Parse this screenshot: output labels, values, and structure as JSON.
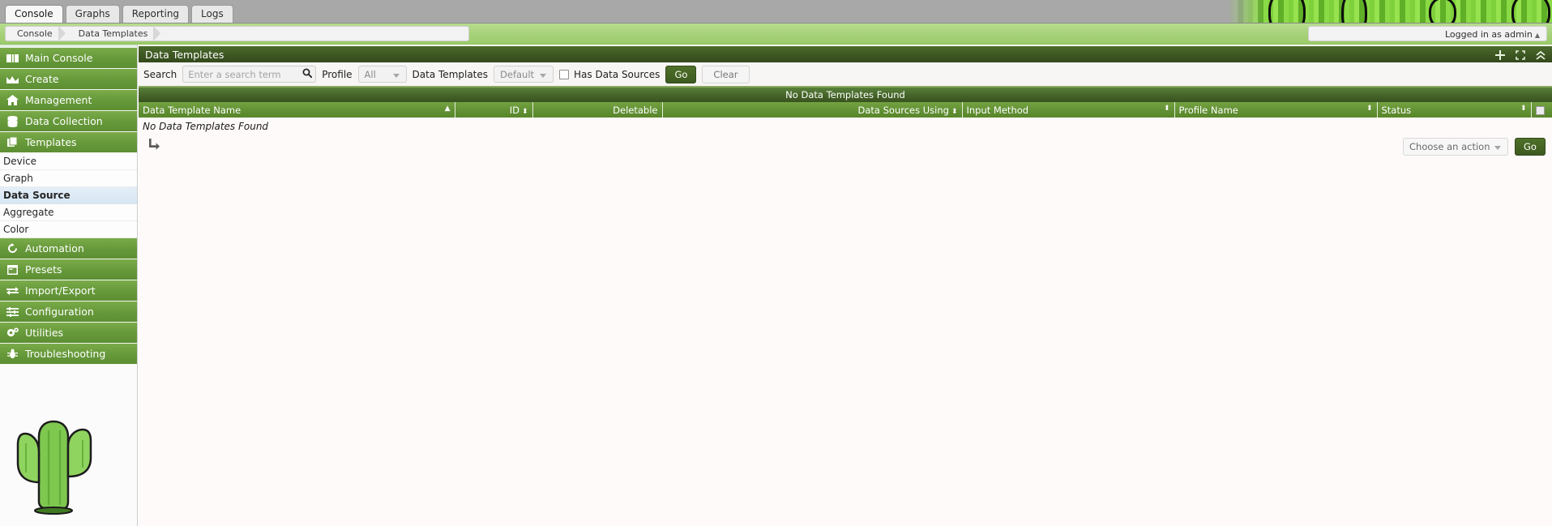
{
  "topbar": {
    "tabs": [
      {
        "label": "Console",
        "active": true
      },
      {
        "label": "Graphs",
        "active": false
      },
      {
        "label": "Reporting",
        "active": false
      },
      {
        "label": "Logs",
        "active": false
      }
    ],
    "banner_icon": "cactus-banner-graphic"
  },
  "breadcrumb": {
    "items": [
      "Console",
      "Data Templates"
    ],
    "login_text": "Logged in as admin",
    "login_caret": "▲"
  },
  "sidebar": {
    "groups": [
      {
        "label": "Main Console",
        "icon": "book-icon"
      },
      {
        "label": "Create",
        "icon": "chart-icon"
      },
      {
        "label": "Management",
        "icon": "home-icon"
      },
      {
        "label": "Data Collection",
        "icon": "database-icon"
      },
      {
        "label": "Templates",
        "icon": "layers-icon"
      }
    ],
    "template_items": [
      {
        "label": "Device",
        "selected": false
      },
      {
        "label": "Graph",
        "selected": false
      },
      {
        "label": "Data Source",
        "selected": true
      },
      {
        "label": "Aggregate",
        "selected": false
      },
      {
        "label": "Color",
        "selected": false
      }
    ],
    "groups_lower": [
      {
        "label": "Automation",
        "icon": "refresh-icon"
      },
      {
        "label": "Presets",
        "icon": "window-icon"
      },
      {
        "label": "Import/Export",
        "icon": "exchange-icon"
      },
      {
        "label": "Configuration",
        "icon": "sliders-icon"
      },
      {
        "label": "Utilities",
        "icon": "gears-icon"
      },
      {
        "label": "Troubleshooting",
        "icon": "bug-icon"
      }
    ],
    "mascot": "cactus-logo"
  },
  "panel": {
    "title": "Data Templates",
    "icons": [
      {
        "name": "add-icon",
        "glyph": "+"
      },
      {
        "name": "expand-icon",
        "glyph": "[ ]"
      },
      {
        "name": "collapse-icon",
        "glyph": "A"
      }
    ]
  },
  "filters": {
    "search_label": "Search",
    "search_placeholder": "Enter a search term",
    "search_value": "",
    "search_icon": "search-icon",
    "profile_label": "Profile",
    "profile_value": "All",
    "data_templates_label": "Data Templates",
    "data_templates_value": "Default",
    "has_data_sources_label": "Has Data Sources",
    "has_data_sources_checked": false,
    "go_label": "Go",
    "clear_label": "Clear"
  },
  "table": {
    "banner": "No Data Templates Found",
    "columns": [
      {
        "label": "Data Template Name",
        "align": "left",
        "sort": "▲"
      },
      {
        "label": "ID",
        "align": "right",
        "sort": "⬍"
      },
      {
        "label": "Deletable",
        "align": "right",
        "sort": ""
      },
      {
        "label": "Data Sources Using",
        "align": "right",
        "sort": "⬍"
      },
      {
        "label": "Input Method",
        "align": "left",
        "sort": "⬍"
      },
      {
        "label": "Profile Name",
        "align": "left",
        "sort": "⬍"
      },
      {
        "label": "Status",
        "align": "left",
        "sort": "⬍"
      },
      {
        "label": "",
        "align": "left",
        "sort": ""
      }
    ],
    "empty_message": "No Data Templates Found",
    "rows": []
  },
  "actions": {
    "turn_arrow_icon": "turn-down-right-icon",
    "action_select_value": "Choose an action",
    "go_label": "Go"
  }
}
